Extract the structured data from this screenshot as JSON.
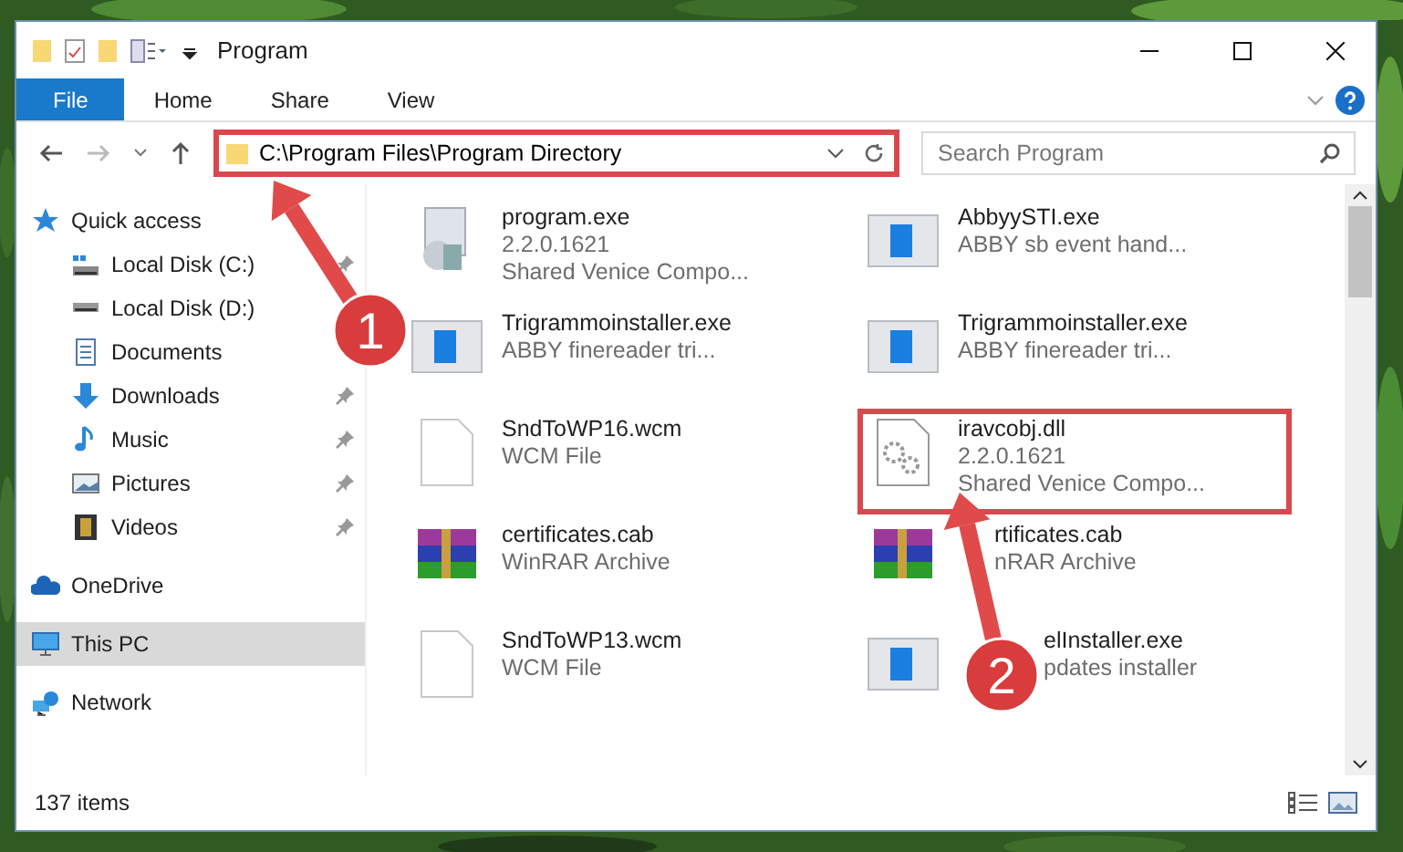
{
  "window": {
    "title": "Program"
  },
  "ribbon_tabs": [
    {
      "label": "File",
      "selected": true
    },
    {
      "label": "Home",
      "selected": false
    },
    {
      "label": "Share",
      "selected": false
    },
    {
      "label": "View",
      "selected": false
    }
  ],
  "address": {
    "path": "C:\\Program Files\\Program Directory",
    "highlighted": true
  },
  "search": {
    "placeholder": "Search Program"
  },
  "sidebar": {
    "items": [
      {
        "label": "Quick access",
        "selected": false,
        "children": [
          {
            "label": "Local Disk (C:)",
            "selected": false,
            "pinned": true
          },
          {
            "label": "Local Disk (D:)",
            "selected": false,
            "pinned": false
          },
          {
            "label": "Documents",
            "selected": false,
            "pinned": false
          },
          {
            "label": "Downloads",
            "selected": false,
            "pinned": true
          },
          {
            "label": "Music",
            "selected": false,
            "pinned": true
          },
          {
            "label": "Pictures",
            "selected": false,
            "pinned": true
          },
          {
            "label": "Videos",
            "selected": false,
            "pinned": true
          }
        ]
      },
      {
        "label": "OneDrive",
        "selected": false
      },
      {
        "label": "This PC",
        "selected": true
      },
      {
        "label": "Network",
        "selected": false
      }
    ]
  },
  "files": [
    {
      "name": "program.exe",
      "lines": [
        "2.2.0.1621",
        "Shared Venice Compo..."
      ],
      "kind": "setup",
      "highlighted": false
    },
    {
      "name": "AbbyySTI.exe",
      "lines": [
        "ABBY sb event hand..."
      ],
      "kind": "app",
      "highlighted": false
    },
    {
      "name": "Trigrammoinstaller.exe",
      "lines": [
        "ABBY finereader tri..."
      ],
      "kind": "app",
      "highlighted": false
    },
    {
      "name": "Trigrammoinstaller.exe",
      "lines": [
        "ABBY finereader tri..."
      ],
      "kind": "app",
      "highlighted": false
    },
    {
      "name": "SndToWP16.wcm",
      "lines": [
        "WCM File"
      ],
      "kind": "blank",
      "highlighted": false
    },
    {
      "name": "iravcobj.dll",
      "lines": [
        "2.2.0.1621",
        "Shared Venice Compo..."
      ],
      "kind": "dll",
      "highlighted": true
    },
    {
      "name": "certificates.cab",
      "lines": [
        "WinRAR Archive"
      ],
      "kind": "archive",
      "highlighted": false
    },
    {
      "name": "rtificates.cab",
      "lines": [
        "nRAR Archive"
      ],
      "kind": "archive",
      "highlighted": false
    },
    {
      "name": "SndToWP13.wcm",
      "lines": [
        "WCM File"
      ],
      "kind": "blank",
      "highlighted": false
    },
    {
      "name": "elInstaller.exe",
      "lines": [
        "pdates installer"
      ],
      "kind": "app",
      "highlighted": false
    }
  ],
  "status_bar": {
    "item_count": "137 items"
  },
  "callouts": [
    {
      "number": "1"
    },
    {
      "number": "2"
    }
  ]
}
